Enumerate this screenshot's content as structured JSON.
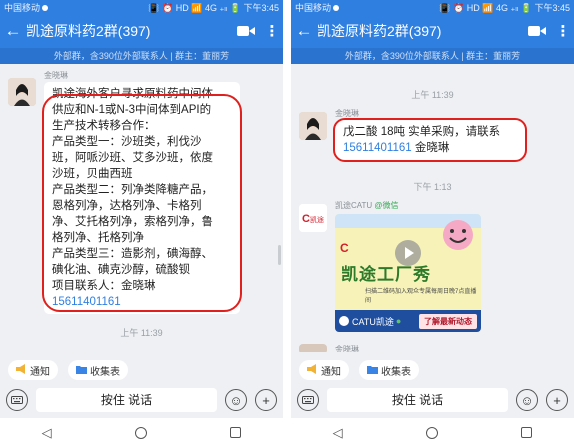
{
  "status_bar": {
    "carrier": "中国移动",
    "icons": "📳 ⏰ HD 📶 4G ₊ₗₗ 🔋",
    "time": "下午3:45"
  },
  "header": {
    "title": "凯途原料药2群(397)",
    "subtitle": "外部群，含390位外部联系人 | 群主：董丽芳"
  },
  "left_chat": {
    "sender": "金晓琳",
    "message_lines": [
      "凯途海外客户寻求原料药中间体",
      "供应和N-1或N-3中间体到API的",
      "生产技术转移合作：",
      "产品类型一：沙班类，利伐沙",
      "班，阿哌沙班、艾多沙班，依度",
      "沙班，贝曲西班",
      "产品类型二：列净类降糖产品，",
      "恩格列净，达格列净、卡格列",
      "净、艾托格列净，索格列净，鲁",
      "格列净、托格列净",
      "产品类型三：造影剂，碘海醇、",
      "碘化油、碘克沙醇，硫酸钡",
      "项目联系人：金晓琳"
    ],
    "phone": "15611401161",
    "time_below": "上午 11:39"
  },
  "right_chat": {
    "time_top": "上午 11:39",
    "sender": "金晓琳",
    "message_line1": "戊二酸 18吨 实单采购，请联系",
    "phone": "15611401161",
    "message_suffix": " 金晓琳",
    "time_mid": "下午 1:13",
    "catu_sender": "凯途CATU",
    "catu_source": "@微信",
    "card_banner": "凯途工厂秀",
    "card_sub": "扫描二维码加入观众专属每周日晚7点直播间",
    "card_channel": "CATU凯途",
    "card_cta": "了解最新动态",
    "next_sender": "金晓琳"
  },
  "quick_actions": [
    {
      "icon": "megaphone-icon",
      "label": "通知"
    },
    {
      "icon": "folder-icon",
      "label": "收集表"
    }
  ],
  "input": {
    "hold_to_talk": "按住 说话"
  },
  "nav": {
    "back": "◁",
    "home": "○",
    "recent": "□"
  },
  "colors": {
    "header_blue": "#2f7fe0",
    "highlight_red": "#e0201d",
    "phone_link": "#2f7fe0"
  }
}
